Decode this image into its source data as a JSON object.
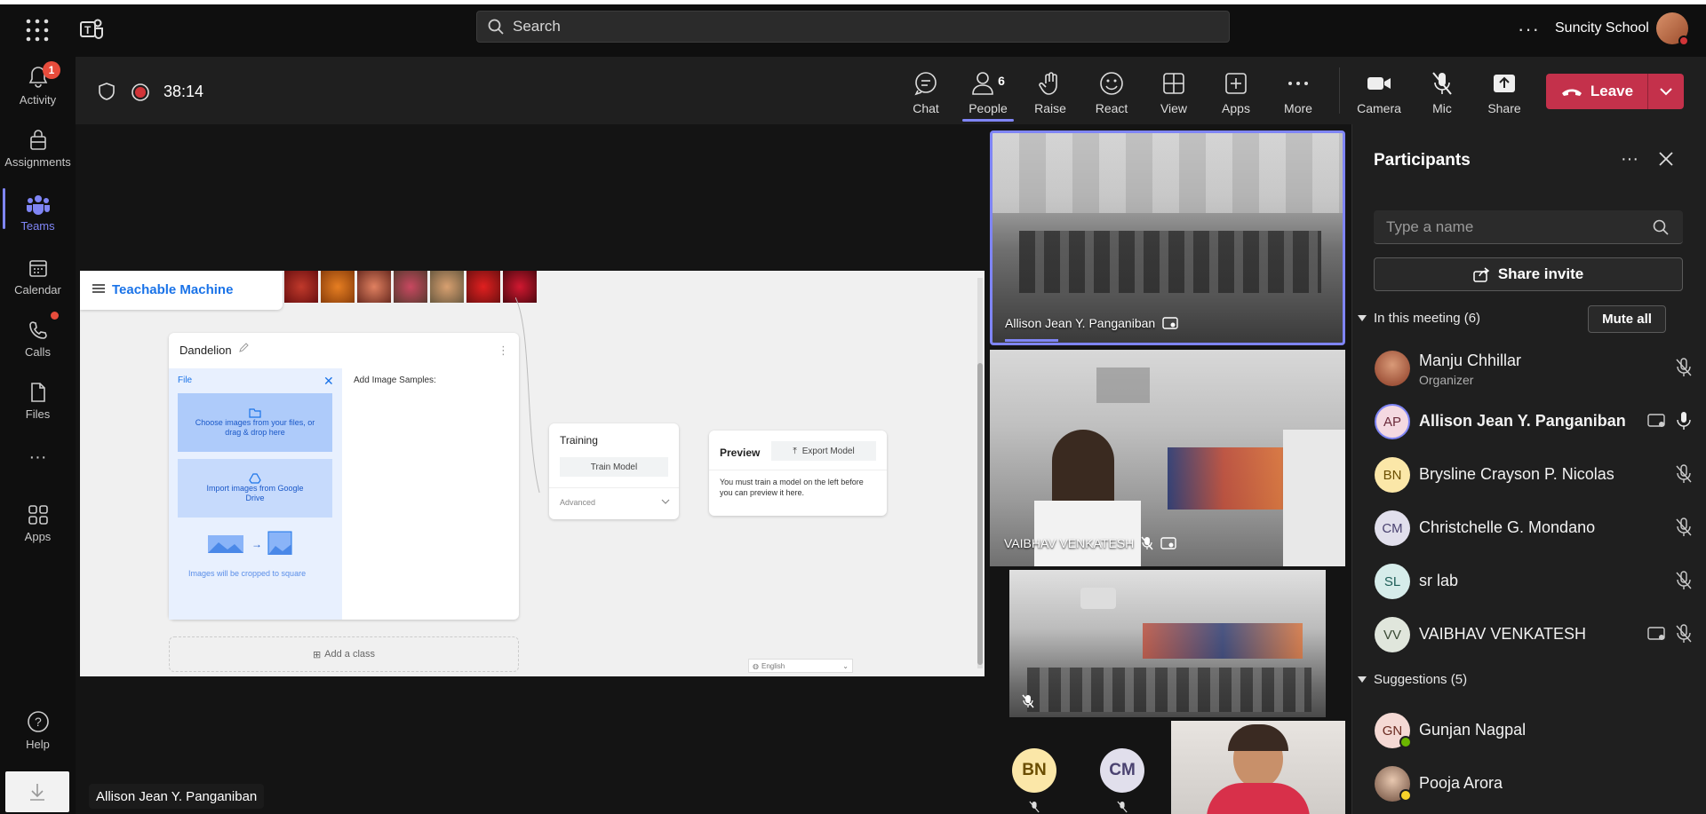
{
  "topbar": {
    "search_placeholder": "Search",
    "more": "···",
    "org_name": "Suncity School"
  },
  "rail": {
    "activity": {
      "label": "Activity",
      "badge": "1"
    },
    "assignments": "Assignments",
    "teams": "Teams",
    "calendar": "Calendar",
    "calls": "Calls",
    "files": "Files",
    "more": "···",
    "apps": "Apps",
    "help": "Help"
  },
  "meeting": {
    "timer": "38:14",
    "people_count": "6",
    "toolbar": {
      "chat": "Chat",
      "people": "People",
      "raise": "Raise",
      "react": "React",
      "view": "View",
      "apps": "Apps",
      "more": "More",
      "camera": "Camera",
      "mic": "Mic",
      "share": "Share",
      "leave": "Leave"
    },
    "share_presenter": "Allison Jean Y. Panganiban"
  },
  "teachable": {
    "title": "Teachable Machine",
    "class_name": "Dandelion",
    "file_label": "File",
    "add_samples": "Add Image Samples:",
    "choose_files": "Choose images from your files, or drag & drop here",
    "import_drive": "Import images from Google Drive",
    "cropped": "Images will be cropped to square",
    "add_class": "Add a class",
    "training": "Training",
    "train_model": "Train Model",
    "advanced": "Advanced",
    "preview": "Preview",
    "export_model": "Export Model",
    "preview_msg": "You must train a model on the left before you can preview it here.",
    "language": "English"
  },
  "videos": {
    "tile1_name": "Allison Jean Y. Panganiban",
    "tile2_name": "VAIBHAV VENKATESH",
    "bn": "BN",
    "cm": "CM"
  },
  "panel": {
    "title": "Participants",
    "search_placeholder": "Type a name",
    "share_invite": "Share invite",
    "in_meeting": "In this meeting (6)",
    "mute_all": "Mute all",
    "suggestions": "Suggestions (5)",
    "participants": [
      {
        "initials": "",
        "name": "Manju Chhillar",
        "role": "Organizer"
      },
      {
        "initials": "AP",
        "name": "Allison Jean Y. Panganiban"
      },
      {
        "initials": "BN",
        "name": "Brysline Crayson P. Nicolas"
      },
      {
        "initials": "CM",
        "name": "Christchelle G. Mondano"
      },
      {
        "initials": "SL",
        "name": "sr lab"
      },
      {
        "initials": "VV",
        "name": "VAIBHAV VENKATESH"
      }
    ],
    "suggested": [
      {
        "initials": "GN",
        "name": "Gunjan Nagpal"
      },
      {
        "initials": "",
        "name": "Pooja Arora"
      }
    ]
  },
  "colors": {
    "accent": "#7f85f5",
    "leave": "#c4314b",
    "background": "#1f1f1f"
  }
}
